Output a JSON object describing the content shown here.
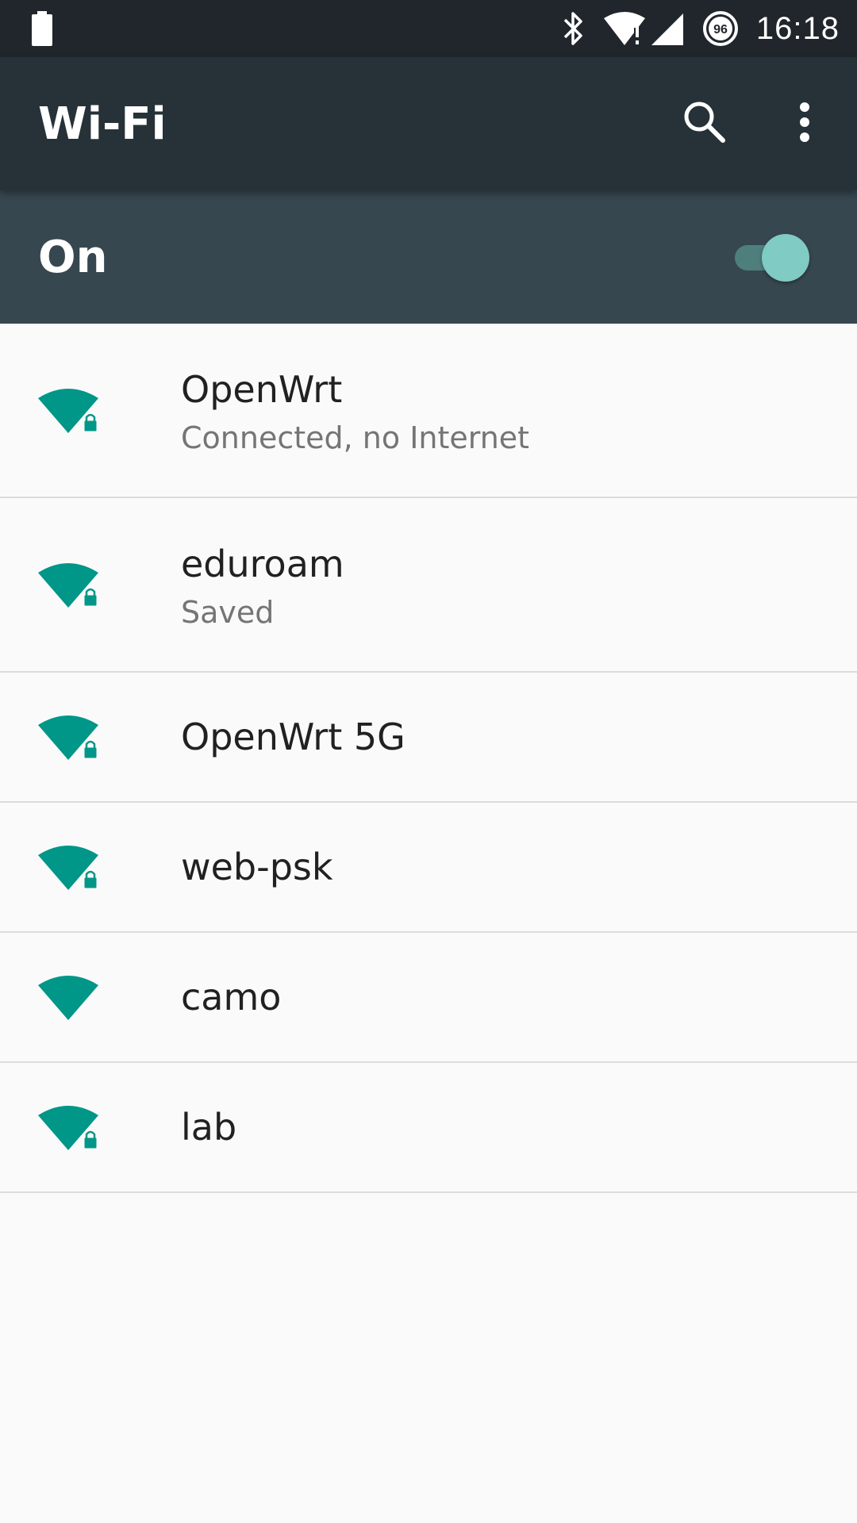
{
  "status_bar": {
    "time": "16:18",
    "data_saver_value": "96",
    "icons": [
      "battery-icon",
      "bluetooth-icon",
      "wifi-no-internet-icon",
      "cell-signal-icon",
      "data-saver-icon"
    ]
  },
  "toolbar": {
    "title": "Wi-Fi",
    "actions": [
      "search-icon",
      "more-vert-icon"
    ]
  },
  "master_switch": {
    "label": "On",
    "state": "on"
  },
  "colors": {
    "status_bar": "#20262b",
    "toolbar": "#263238",
    "switch_bar": "#37474f",
    "accent": "#009688",
    "toggle_thumb": "#80cbc4"
  },
  "networks": [
    {
      "name": "OpenWrt",
      "status": "Connected, no Internet",
      "secured": true
    },
    {
      "name": "eduroam",
      "status": "Saved",
      "secured": true
    },
    {
      "name": "OpenWrt 5G",
      "status": "",
      "secured": true
    },
    {
      "name": "web-psk",
      "status": "",
      "secured": true
    },
    {
      "name": "camo",
      "status": "",
      "secured": false
    },
    {
      "name": "lab",
      "status": "",
      "secured": true
    }
  ]
}
